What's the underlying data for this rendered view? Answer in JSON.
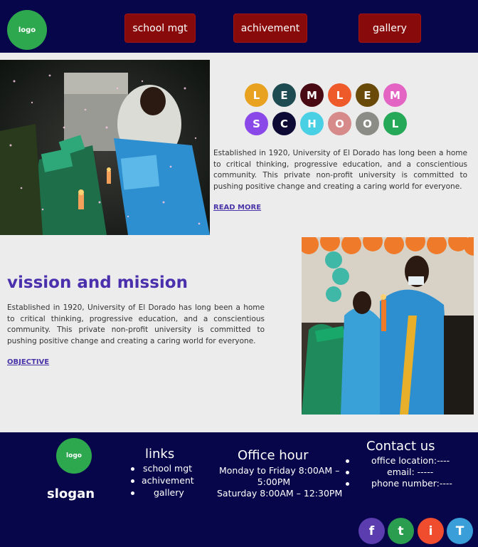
{
  "header": {
    "logo": "logo",
    "nav": [
      "school mgt",
      "achivement",
      "gallery"
    ]
  },
  "letters": [
    {
      "char": "L",
      "color": "#e8a21f"
    },
    {
      "char": "E",
      "color": "#1e4a52"
    },
    {
      "char": "M",
      "color": "#4a0a14"
    },
    {
      "char": "L",
      "color": "#ee5a2a"
    },
    {
      "char": "E",
      "color": "#6a4a08"
    },
    {
      "char": "M",
      "color": "#e464c4"
    },
    {
      "char": "S",
      "color": "#8a48e8"
    },
    {
      "char": "C",
      "color": "#0d0b36"
    },
    {
      "char": "H",
      "color": "#4ad0e4"
    },
    {
      "char": "O",
      "color": "#d68a8a"
    },
    {
      "char": "O",
      "color": "#8c8c86"
    },
    {
      "char": "L",
      "color": "#25a857"
    }
  ],
  "intro": {
    "text": "Established in 1920, University of El Dorado has long been a home to critical thinking, progressive education, and a conscientious community. This private non-profit university is committed to pushing positive change and creating a caring world for everyone.",
    "link": "READ MORE "
  },
  "vision": {
    "title": "vission and mission",
    "text": "Established in 1920, University of El Dorado has long been a home to critical thinking, progressive education, and a conscientious community. This private non-profit university is committed to pushing positive change and creating a caring world for everyone.",
    "link": "OBJECTIVE"
  },
  "footer": {
    "logo": "logo",
    "slogan": "slogan",
    "links_title": "links",
    "links": [
      "school mgt",
      "achivement",
      "gallery"
    ],
    "office_title": "Office hour",
    "office_line1": "Monday to Friday 8:00AM –",
    "office_line2": "5:00PM",
    "office_line3": "Saturday 8:00AM – 12:30PM",
    "contact_title": "Contact us",
    "contact": [
      "office location:----",
      "email: -----",
      "phone number:----"
    ]
  },
  "social": [
    {
      "label": "f",
      "icon": "facebook-icon",
      "color": "#5b3db0"
    },
    {
      "label": "t",
      "icon": "twitter-icon",
      "color": "#2a9d4e"
    },
    {
      "label": "i",
      "icon": "instagram-icon",
      "color": "#f04c2e"
    },
    {
      "label": "T",
      "icon": "telegram-icon",
      "color": "#3a9ed8"
    }
  ]
}
